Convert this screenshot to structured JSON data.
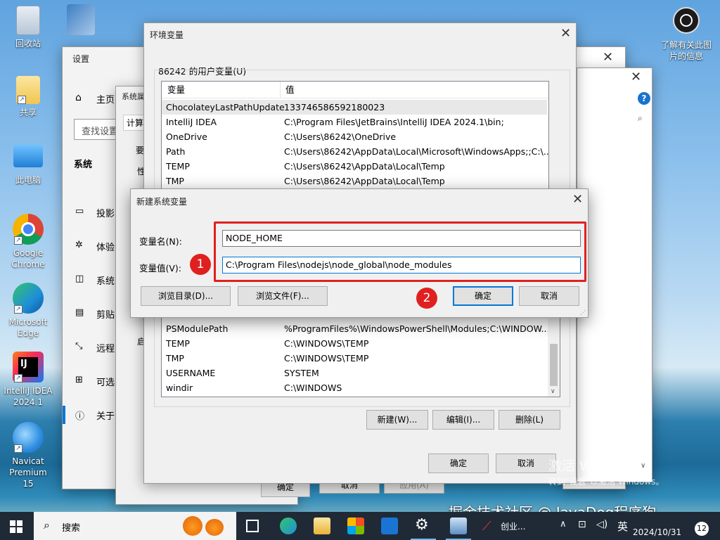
{
  "desktop": {
    "icons": [
      {
        "label": "回收站"
      },
      {
        "label": "共享"
      },
      {
        "label": "此电脑"
      },
      {
        "label": "Google Chrome"
      },
      {
        "label": "Microsoft Edge"
      },
      {
        "label": "IntelliJ IDEA 2024.1"
      },
      {
        "label": "Navicat Premium 15"
      }
    ],
    "right_icon_label": "了解有关此图片的信息"
  },
  "settings_window": {
    "title": "设置",
    "home_label": "主页",
    "search_placeholder": "查找设置",
    "section": "系统",
    "nav": [
      "投影",
      "体验",
      "系统",
      "剪贴",
      "远程",
      "可选",
      "关于"
    ]
  },
  "sysprops_window": {
    "title": "系统属",
    "tab": "计算",
    "text1": "要",
    "text2": "性",
    "text3": "启",
    "buttons": {
      "ok": "确定",
      "cancel": "取消",
      "apply": "应用(A)"
    }
  },
  "env_window": {
    "title": "环境变量",
    "user_group_label": "86242 的用户变量(U)",
    "columns": {
      "name": "变量",
      "value": "值"
    },
    "user_vars": [
      {
        "name": "ChocolateyLastPathUpdate",
        "value": "133746586592180023"
      },
      {
        "name": "IntelliJ IDEA",
        "value": "C:\\Program Files\\JetBrains\\IntelliJ IDEA 2024.1\\bin;"
      },
      {
        "name": "OneDrive",
        "value": "C:\\Users\\86242\\OneDrive"
      },
      {
        "name": "Path",
        "value": "C:\\Users\\86242\\AppData\\Local\\Microsoft\\WindowsApps;;C:\\..."
      },
      {
        "name": "TEMP",
        "value": "C:\\Users\\86242\\AppData\\Local\\Temp"
      },
      {
        "name": "TMP",
        "value": "C:\\Users\\86242\\AppData\\Local\\Temp"
      }
    ],
    "system_vars": [
      {
        "name": "PSModulePath",
        "value": "%ProgramFiles%\\WindowsPowerShell\\Modules;C:\\WINDOW..."
      },
      {
        "name": "TEMP",
        "value": "C:\\WINDOWS\\TEMP"
      },
      {
        "name": "TMP",
        "value": "C:\\WINDOWS\\TEMP"
      },
      {
        "name": "USERNAME",
        "value": "SYSTEM"
      },
      {
        "name": "windir",
        "value": "C:\\WINDOWS"
      }
    ],
    "sys_buttons": {
      "new": "新建(W)...",
      "edit": "编辑(I)...",
      "delete": "删除(L)"
    },
    "buttons": {
      "ok": "确定",
      "cancel": "取消"
    }
  },
  "new_var_dialog": {
    "title": "新建系统变量",
    "name_label": "变量名(N):",
    "value_label": "变量值(V):",
    "name_value": "NODE_HOME",
    "value_value": "C:\\Program Files\\nodejs\\node_global\\node_modules",
    "browse_dir": "浏览目录(D)...",
    "browse_file": "浏览文件(F)...",
    "ok": "确定",
    "cancel": "取消",
    "markers": [
      "1",
      "2"
    ]
  },
  "watermark": {
    "activate_title": "激活 Windows",
    "activate_sub": "转到\"设置\"以激活 Windows。",
    "site": "掘金技术社区 @ JavaDog程序狗"
  },
  "taskbar": {
    "search_label": "搜索",
    "app_label": "创业...",
    "ime": "英",
    "date": "2024/10/31",
    "notifications": "12"
  },
  "colors": {
    "accent": "#0078d7",
    "annotation_red": "#e02020",
    "taskbar": "#1f2a36"
  }
}
